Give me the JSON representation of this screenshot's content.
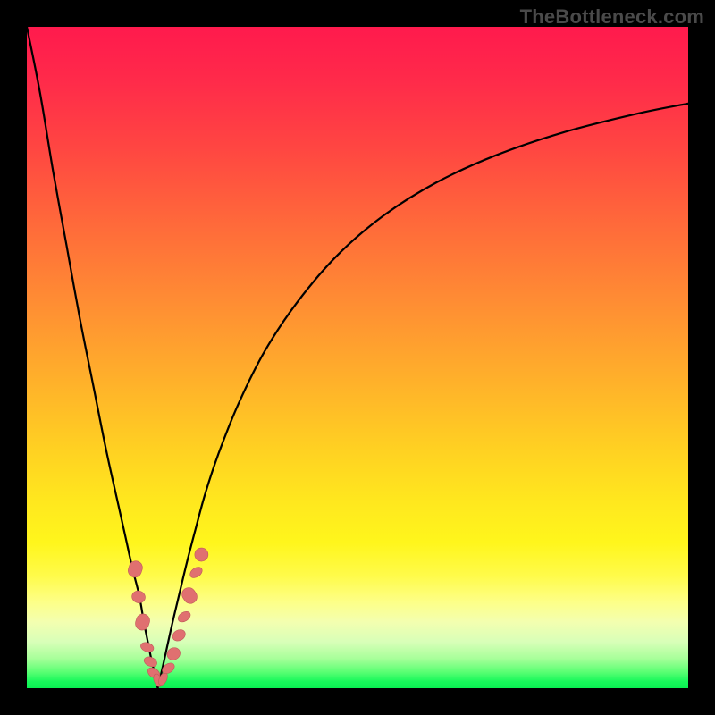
{
  "watermark": "TheBottleneck.com",
  "chart_data": {
    "type": "line",
    "title": "",
    "xlabel": "",
    "ylabel": "",
    "xlim": [
      0,
      100
    ],
    "ylim": [
      0,
      100
    ],
    "grid": false,
    "gradient_background": {
      "orientation": "vertical",
      "top": "#ff1a4d",
      "middle": "#ffe81e",
      "bottom": "#17f85a"
    },
    "series": [
      {
        "name": "left-branch",
        "x": [
          0.0,
          2.0,
          4.0,
          6.0,
          8.0,
          10.0,
          12.0,
          14.0,
          15.0,
          16.0,
          17.0,
          17.7,
          18.3,
          18.9,
          19.4,
          19.8
        ],
        "y": [
          100.0,
          90.0,
          78.0,
          67.0,
          56.0,
          46.0,
          36.0,
          27.0,
          22.5,
          18.0,
          14.0,
          10.0,
          7.0,
          4.0,
          2.0,
          0.0
        ]
      },
      {
        "name": "right-branch",
        "x": [
          19.8,
          20.5,
          21.2,
          22.0,
          23.0,
          24.2,
          25.5,
          27.0,
          29.0,
          32.0,
          36.0,
          41.0,
          47.0,
          54.0,
          62.0,
          71.0,
          81.0,
          92.0,
          100.0
        ],
        "y": [
          0.0,
          3.0,
          6.2,
          9.8,
          14.0,
          19.0,
          24.0,
          29.5,
          35.5,
          43.0,
          51.0,
          58.5,
          65.5,
          71.5,
          76.5,
          80.6,
          84.0,
          86.8,
          88.4
        ]
      }
    ],
    "annotations": {
      "name": "beads",
      "comment": "pink capsule markers clustered near the minimum of the V",
      "points": [
        {
          "x": 16.4,
          "y": 18.0,
          "len": 5.5,
          "angle": -72
        },
        {
          "x": 16.9,
          "y": 13.8,
          "len": 4.0,
          "angle": -72
        },
        {
          "x": 17.5,
          "y": 10.0,
          "len": 5.5,
          "angle": -72
        },
        {
          "x": 18.2,
          "y": 6.2,
          "len": 3.0,
          "angle": -70
        },
        {
          "x": 18.7,
          "y": 4.0,
          "len": 3.0,
          "angle": -68
        },
        {
          "x": 19.2,
          "y": 2.3,
          "len": 3.0,
          "angle": -55
        },
        {
          "x": 19.8,
          "y": 1.2,
          "len": 2.5,
          "angle": -20
        },
        {
          "x": 20.6,
          "y": 1.4,
          "len": 2.5,
          "angle": 25
        },
        {
          "x": 21.4,
          "y": 3.0,
          "len": 3.0,
          "angle": 55
        },
        {
          "x": 22.2,
          "y": 5.2,
          "len": 4.0,
          "angle": 60
        },
        {
          "x": 23.0,
          "y": 8.0,
          "len": 3.5,
          "angle": 60
        },
        {
          "x": 23.8,
          "y": 10.8,
          "len": 3.0,
          "angle": 58
        },
        {
          "x": 24.6,
          "y": 14.0,
          "len": 5.5,
          "angle": 56
        },
        {
          "x": 25.6,
          "y": 17.5,
          "len": 3.0,
          "angle": 54
        },
        {
          "x": 26.4,
          "y": 20.2,
          "len": 4.5,
          "angle": 52
        }
      ]
    }
  }
}
